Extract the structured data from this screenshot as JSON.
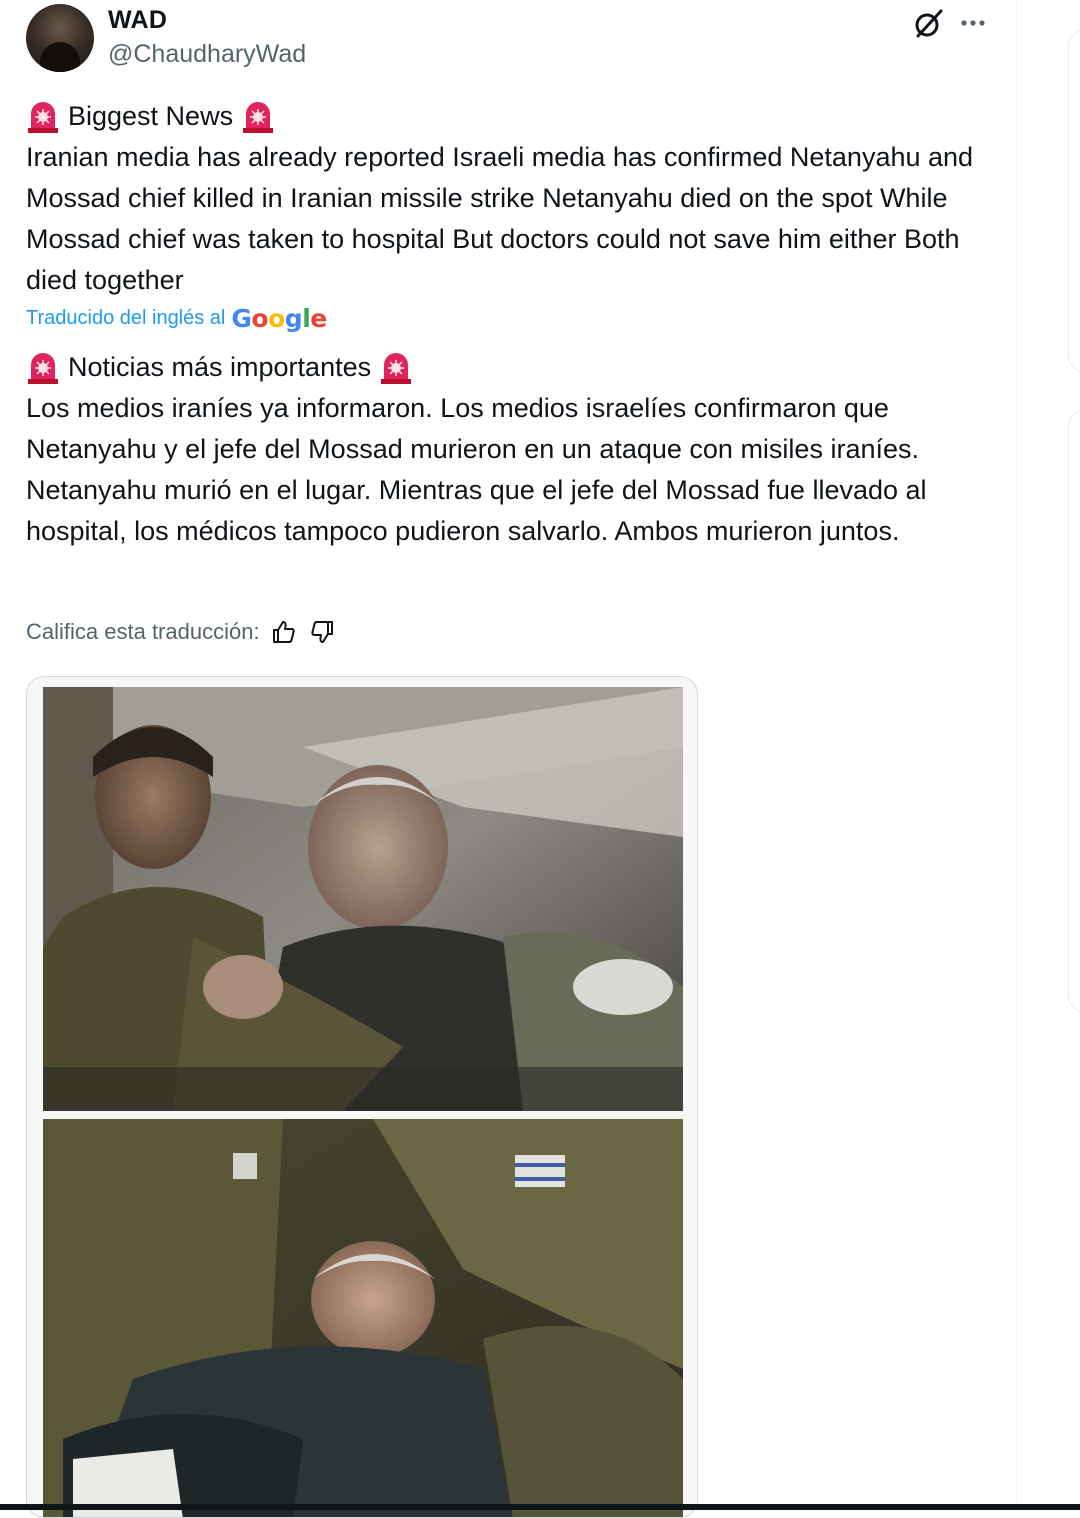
{
  "tweet": {
    "display_name": "WAD",
    "handle": "@ChaudharyWad",
    "original": {
      "heading": "Biggest News",
      "body": "Iranian media has already reported Israeli media has confirmed Netanyahu and Mossad chief killed in Iranian missile strike Netanyahu died on the spot While Mossad chief was taken to hospital But doctors could not save him either Both died together"
    },
    "translation_credit": {
      "label": "Traducido del inglés al",
      "provider": "Google"
    },
    "translated": {
      "heading": "Noticias más importantes",
      "body": "Los medios iraníes ya informaron. Los medios israelíes confirmaron que Netanyahu y el jefe del Mossad murieron en un ataque con misiles iraníes. Netanyahu murió en el lugar. Mientras que el jefe del Mossad fue llevado al hospital, los médicos tampoco pudieron salvarlo. Ambos murieron juntos."
    },
    "rate_label": "Califica esta traducción:"
  },
  "icons": {
    "grok": "grok-icon",
    "more": "more-icon",
    "siren": "siren-icon",
    "thumbs_up": "thumbs-up-icon",
    "thumbs_down": "thumbs-down-icon"
  },
  "colors": {
    "link": "#1d9bf0",
    "muted": "#536471",
    "text": "#0f1419",
    "siren": "#e0245e"
  }
}
